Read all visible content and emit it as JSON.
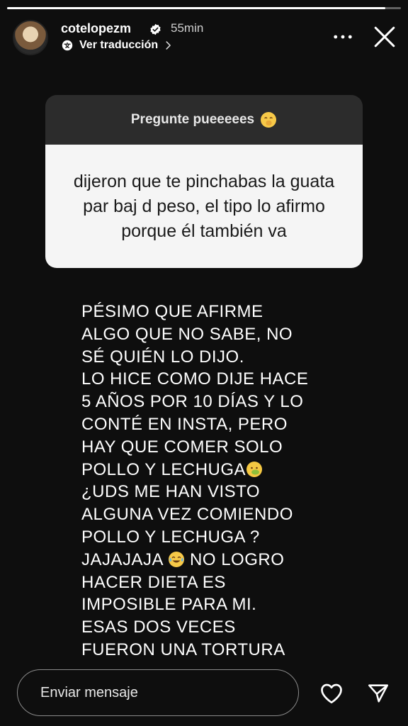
{
  "story": {
    "progress": 0.96
  },
  "header": {
    "username": "cotelopezm",
    "time": "55min",
    "translate_label": "Ver traducción"
  },
  "question_box": {
    "prompt": "Pregunte pueeeees",
    "prompt_emoji": "hand-over-mouth-emoji",
    "question": "dijeron que te pinchabas la guata par baj d peso, el tipo lo afirmo porque él también va"
  },
  "answer": {
    "part1": "PÉSIMO QUE AFIRME\nALGO QUE NO SABE, NO\nSÉ QUIÉN LO DIJO.\nLO HICE COMO DIJE HACE\n5 AÑOS POR 10 DÍAS Y LO\nCONTÉ EN INSTA, PERO\nHAY QUE COMER SOLO\nPOLLO Y LECHUGA",
    "part2": "\n¿UDS ME HAN VISTO\nALGUNA VEZ COMIENDO\nPOLLO Y LECHUGA ?\nJAJAJAJA ",
    "part3": " NO LOGRO\nHACER DIETA ES\nIMPOSIBLE PARA MI.\nESAS DOS VECES\nFUERON UNA TORTURA",
    "emoji_1": "nauseated-face-emoji",
    "emoji_2": "tears-of-joy-emoji"
  },
  "footer": {
    "message_placeholder": "Enviar mensaje"
  },
  "icons": [
    "verified-icon",
    "translate-icon",
    "more-icon",
    "close-icon",
    "heart-icon",
    "send-icon"
  ]
}
